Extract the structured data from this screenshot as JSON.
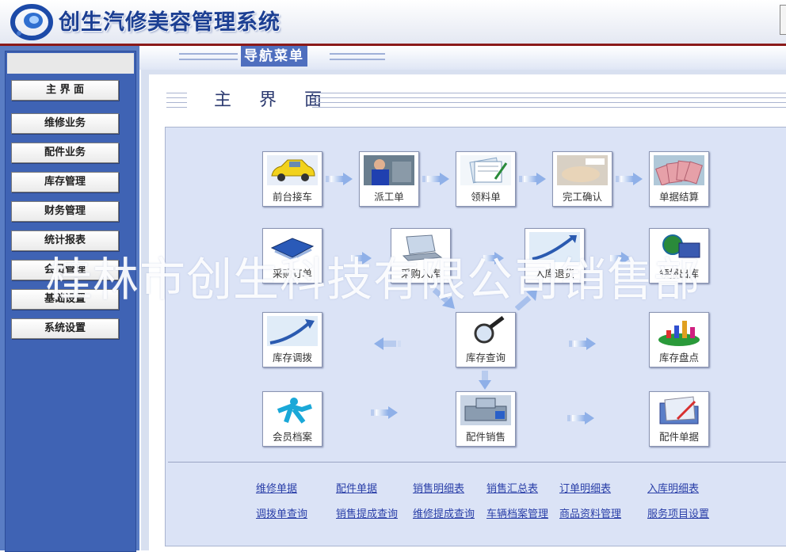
{
  "header": {
    "title": "创生汽修美容管理系统"
  },
  "nav_header": {
    "title": "导航菜单"
  },
  "sidebar": {
    "items": [
      {
        "label": "主 界 面"
      },
      {
        "label": "维修业务"
      },
      {
        "label": "配件业务"
      },
      {
        "label": "库存管理"
      },
      {
        "label": "财务管理"
      },
      {
        "label": "统计报表"
      },
      {
        "label": "会员管理"
      },
      {
        "label": "基础设置"
      },
      {
        "label": "系统设置"
      }
    ]
  },
  "main": {
    "title": "主 界 面",
    "flow": {
      "row1": [
        "前台接车",
        "派工单",
        "领料单",
        "完工确认",
        "单据结算"
      ],
      "row2": [
        "采购订单",
        "采购入库",
        "入库退货",
        "领报出库"
      ],
      "row3": [
        "库存调拨",
        "库存查询",
        "库存盘点"
      ],
      "row4": [
        "会员档案",
        "配件销售",
        "配件单据"
      ]
    },
    "links": {
      "row1": [
        "维修单据",
        "配件单据",
        "销售明细表",
        "销售汇总表",
        "订单明细表",
        "入库明细表"
      ],
      "row2": [
        "调拨单查询",
        "销售提成查询",
        "维修提成查询",
        "车辆档案管理",
        "商品资料管理",
        "服务项目设置"
      ]
    }
  },
  "watermark": "桂林市创生科技有限公司销售部",
  "colors": {
    "brand_blue": "#1c3f93",
    "sidebar": "#3f63b4",
    "header_rule": "#8b1a1a",
    "link": "#2a3fa8"
  }
}
